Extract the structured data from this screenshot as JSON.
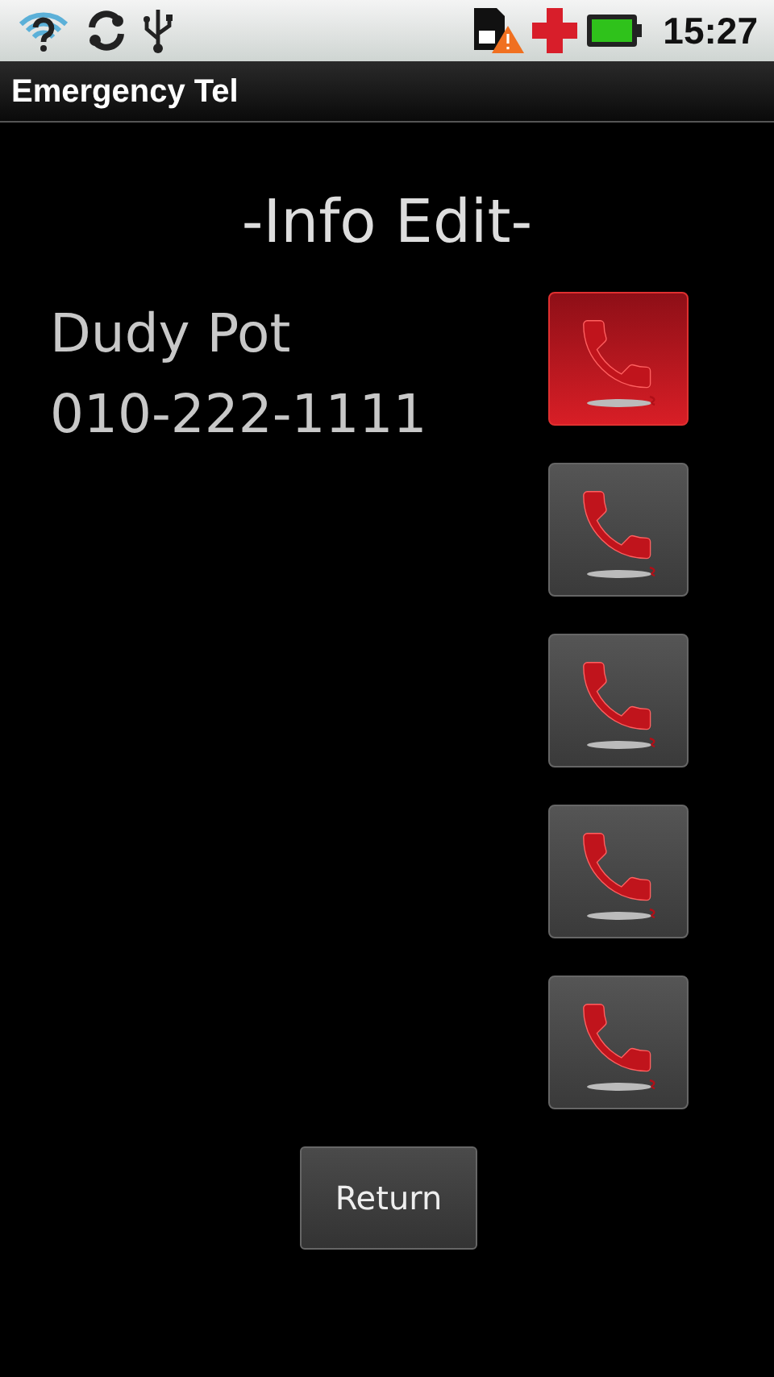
{
  "status_bar": {
    "time": "15:27"
  },
  "app_bar": {
    "title": "Emergency Tel"
  },
  "heading": "-Info Edit-",
  "contact": {
    "name": "Dudy Pot",
    "phone": "010-222-1111"
  },
  "call_buttons": [
    {
      "selected": true
    },
    {
      "selected": false
    },
    {
      "selected": false
    },
    {
      "selected": false
    },
    {
      "selected": false
    }
  ],
  "return_button": {
    "label": "Return"
  }
}
